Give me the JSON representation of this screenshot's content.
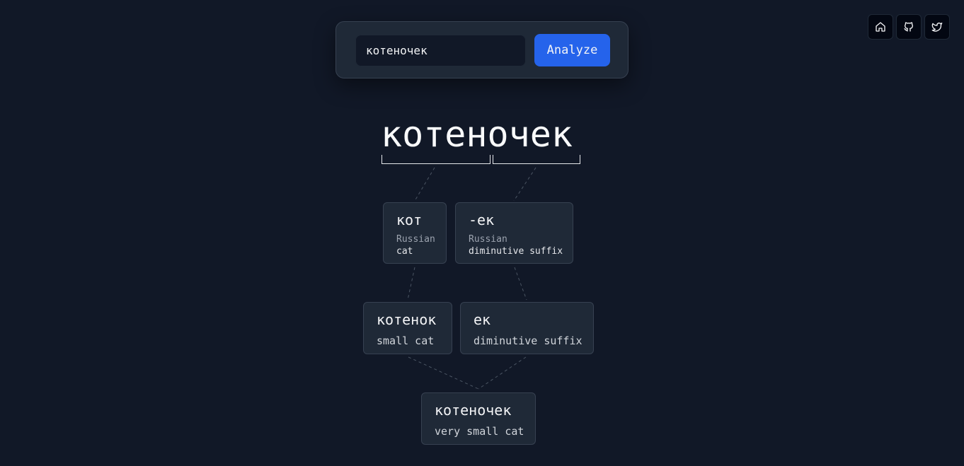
{
  "search": {
    "value": "котеночек",
    "button_label": "Analyze"
  },
  "nav": {
    "home_icon": "home-icon",
    "github_icon": "github-icon",
    "twitter_icon": "twitter-icon"
  },
  "word": "котеночек",
  "roots": [
    {
      "form": "кот",
      "language": "Russian",
      "meaning": "cat"
    },
    {
      "form": "-ек",
      "language": "Russian",
      "meaning": "diminutive suffix"
    }
  ],
  "intermediate": [
    {
      "form": "котенок",
      "meaning": "small cat"
    },
    {
      "form": "ек",
      "meaning": "diminutive suffix"
    }
  ],
  "result": {
    "form": "котеночек",
    "meaning": "very small cat"
  },
  "colors": {
    "background": "#111827",
    "panel": "#1f2937",
    "accent": "#2563eb",
    "border": "#374151"
  }
}
